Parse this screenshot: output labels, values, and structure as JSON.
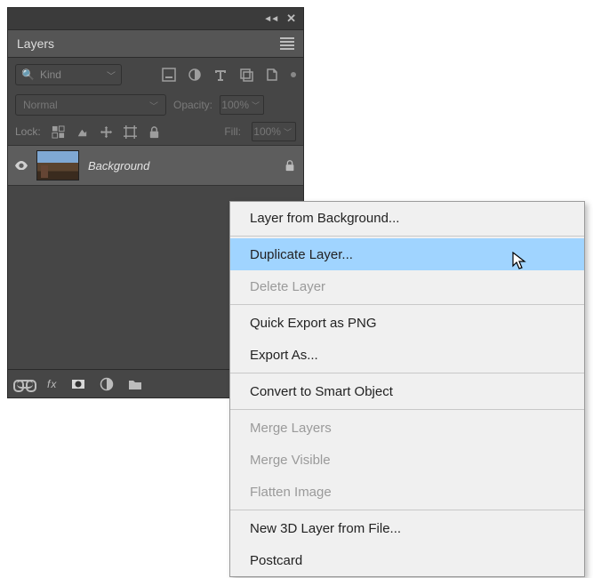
{
  "panel": {
    "title": "Layers",
    "kind_label": "Kind",
    "blend_mode": "Normal",
    "opacity_label": "Opacity:",
    "opacity_value": "100%",
    "lock_label": "Lock:",
    "fill_label": "Fill:",
    "fill_value": "100%",
    "layer": {
      "name": "Background"
    },
    "fx_label": "fx"
  },
  "context_menu": {
    "items": [
      {
        "label": "Layer from Background...",
        "enabled": true
      },
      {
        "sep": true
      },
      {
        "label": "Duplicate Layer...",
        "enabled": true,
        "highlight": true
      },
      {
        "label": "Delete Layer",
        "enabled": false
      },
      {
        "sep": true
      },
      {
        "label": "Quick Export as PNG",
        "enabled": true
      },
      {
        "label": "Export As...",
        "enabled": true
      },
      {
        "sep": true
      },
      {
        "label": "Convert to Smart Object",
        "enabled": true
      },
      {
        "sep": true
      },
      {
        "label": "Merge Layers",
        "enabled": false
      },
      {
        "label": "Merge Visible",
        "enabled": false
      },
      {
        "label": "Flatten Image",
        "enabled": false
      },
      {
        "sep": true
      },
      {
        "label": "New 3D Layer from File...",
        "enabled": true
      },
      {
        "label": "Postcard",
        "enabled": true
      }
    ]
  }
}
